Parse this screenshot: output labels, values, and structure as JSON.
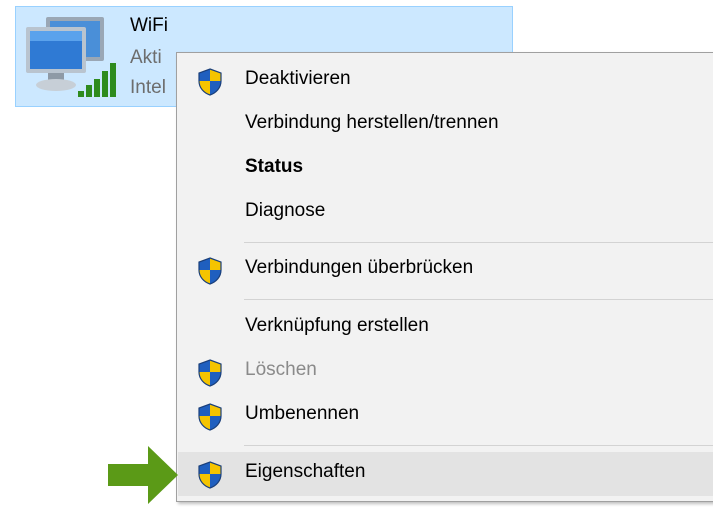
{
  "adapter": {
    "name": "WiFi",
    "status": "Akti",
    "device": "Intel",
    "icon": "network-adapter-icon",
    "signal_icon": "wifi-signal-icon"
  },
  "context_menu": {
    "items": [
      {
        "label": "Deaktivieren",
        "shield": true,
        "style": "normal"
      },
      {
        "label": "Verbindung herstellen/trennen",
        "shield": false,
        "style": "normal"
      },
      {
        "label": "Status",
        "shield": false,
        "style": "bold"
      },
      {
        "label": "Diagnose",
        "shield": false,
        "style": "normal"
      },
      {
        "label": "Verbindungen überbrücken",
        "shield": true,
        "style": "normal"
      },
      {
        "label": "Verknüpfung erstellen",
        "shield": false,
        "style": "normal"
      },
      {
        "label": "Löschen",
        "shield": true,
        "style": "disabled"
      },
      {
        "label": "Umbenennen",
        "shield": true,
        "style": "normal"
      },
      {
        "label": "Eigenschaften",
        "shield": true,
        "style": "highlighted"
      }
    ]
  },
  "colors": {
    "selection_background": "#cce8ff",
    "selection_border": "#99d1ff",
    "menu_background": "#f2f2f2",
    "menu_hover": "#e3e3e3",
    "disabled_text": "#8a8a8a",
    "pointer_arrow": "#5b9a17",
    "shield_blue": "#1f5fbf",
    "shield_yellow": "#f5c400"
  }
}
